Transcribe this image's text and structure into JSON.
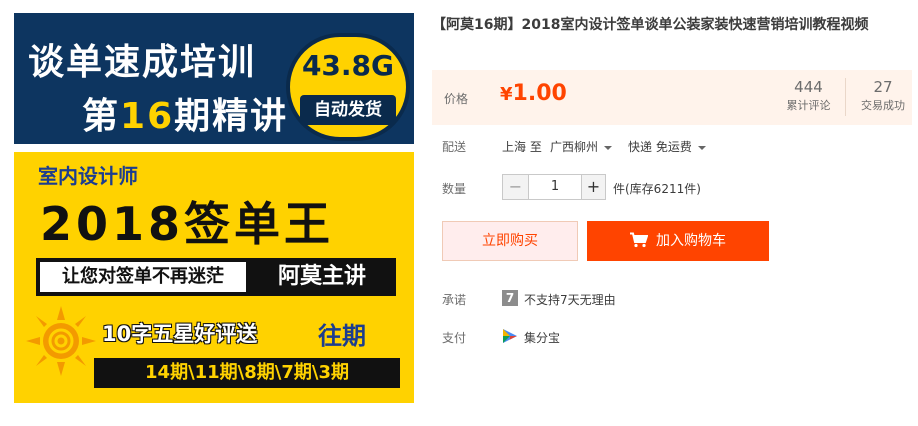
{
  "banner": {
    "title_line1": "谈单速成培训",
    "title_line2_prefix": "第",
    "title_line2_num": "16",
    "title_line2_suffix": "期精讲",
    "size": "43.8G",
    "auto_ship": "自动发货",
    "subtitle": "室内设计师",
    "big_title": "2018签单王",
    "slogan": "让您对签单不再迷茫",
    "lecturer": "阿莫主讲",
    "review_offer": "10字五星好评送",
    "past_label": "往期",
    "past_issues": "14期\\11期\\8期\\7期\\3期"
  },
  "product": {
    "title": "【阿莫16期】2018室内设计签单谈单公装家装快速营销培训教程视频"
  },
  "price": {
    "label": "价格",
    "currency": "¥",
    "value": "1.00"
  },
  "stats": {
    "reviews_count": "444",
    "reviews_label": "累计评论",
    "deals_count": "27",
    "deals_label": "交易成功"
  },
  "delivery": {
    "label": "配送",
    "from": "上海 至",
    "to": "广西柳州",
    "fee": "快递 免运费"
  },
  "quantity": {
    "label": "数量",
    "minus": "−",
    "value": "1",
    "plus": "+",
    "stock": "件(库存6211件)"
  },
  "actions": {
    "buy_now": "立即购买",
    "add_cart": "加入购物车"
  },
  "promise": {
    "label": "承诺",
    "icon_text": "7",
    "text": "不支持7天无理由"
  },
  "payment": {
    "label": "支付",
    "text": "集分宝"
  },
  "colors": {
    "accent": "#ff4400",
    "price_bg": "#fff3eb",
    "banner_navy": "#0d3560",
    "banner_yellow": "#ffd200"
  }
}
